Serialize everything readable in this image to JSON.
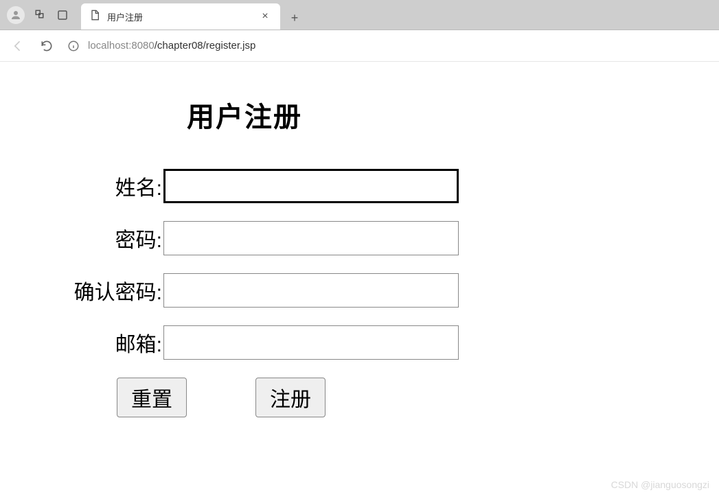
{
  "browser": {
    "tab_title": "用户注册",
    "url_host": "localhost",
    "url_port": ":8080",
    "url_path": "/chapter08/register.jsp"
  },
  "page": {
    "title": "用户注册",
    "fields": {
      "name": {
        "label": "姓名:",
        "value": ""
      },
      "password": {
        "label": "密码:",
        "value": ""
      },
      "confirm_password": {
        "label": "确认密码:",
        "value": ""
      },
      "email": {
        "label": "邮箱:",
        "value": ""
      }
    },
    "buttons": {
      "reset": "重置",
      "submit": "注册"
    }
  },
  "watermark": "CSDN @jianguosongzi"
}
